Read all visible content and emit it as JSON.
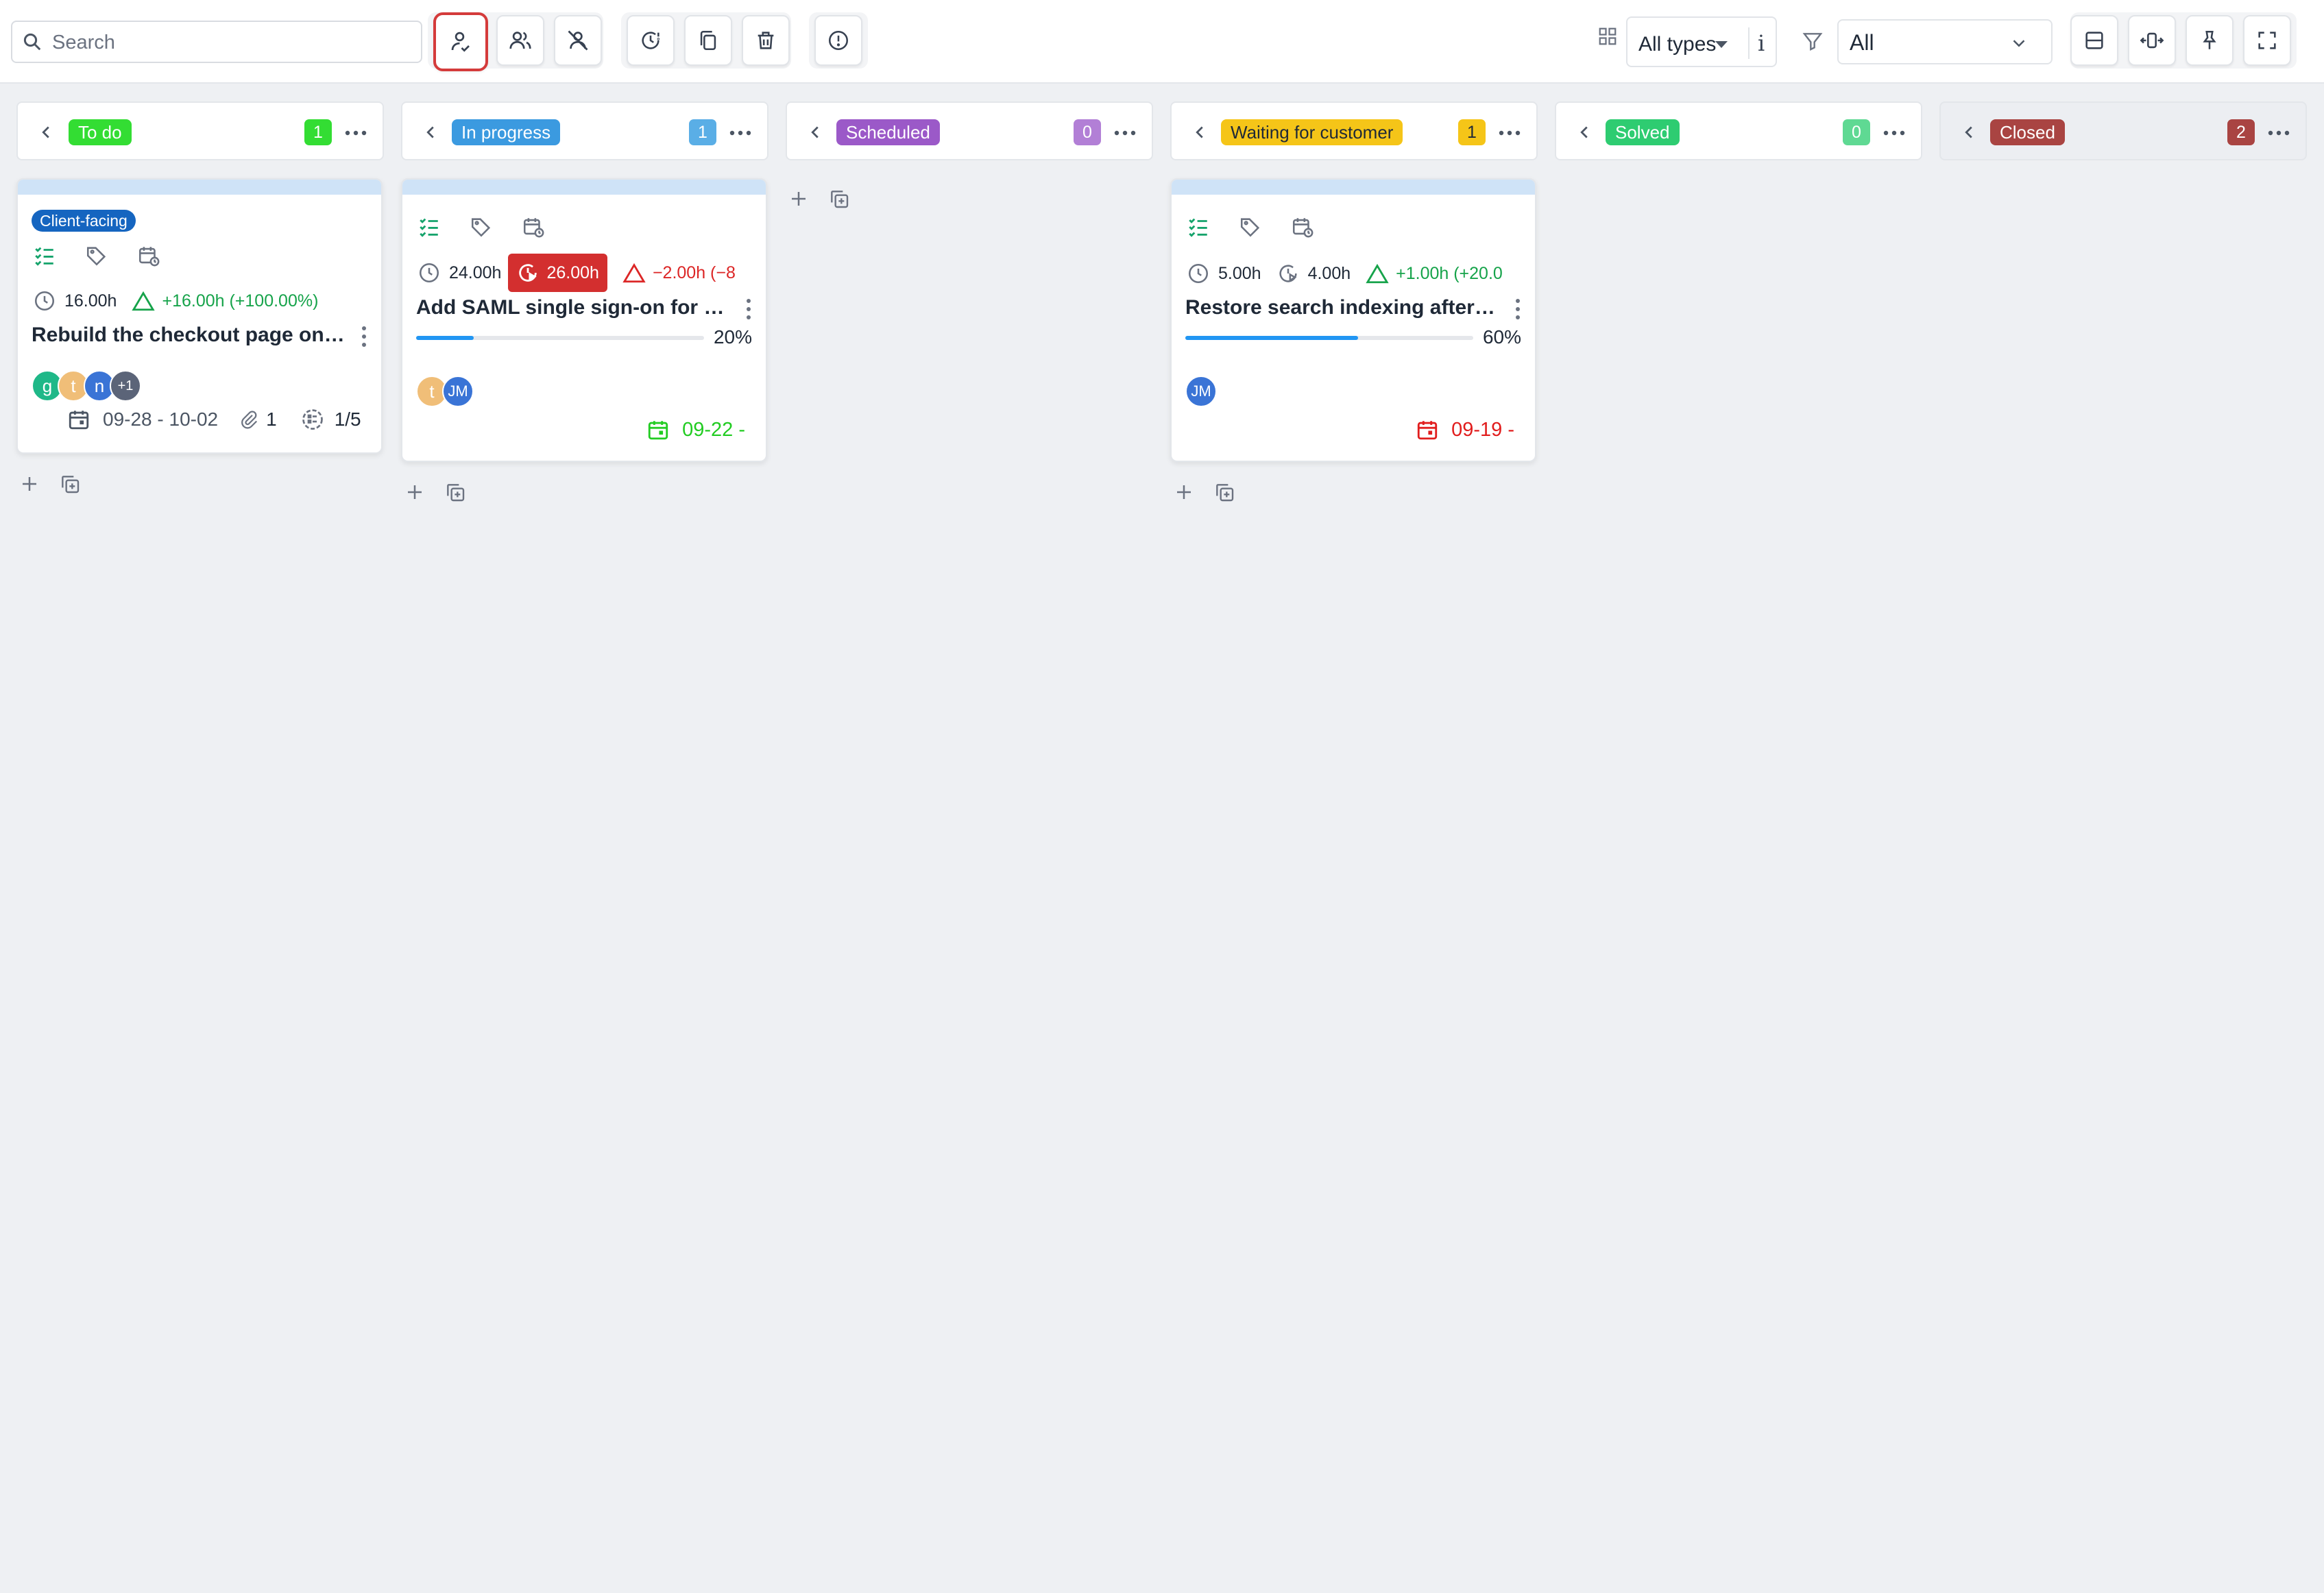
{
  "toolbar": {
    "search_placeholder": "Search",
    "types_value": "All types",
    "types_info": "i",
    "filter_value": "All"
  },
  "colors": {
    "todo": "#33dd33",
    "in_progress": "#3b9ae0",
    "scheduled": "#9b59c8",
    "waiting": "#f5c518",
    "solved": "#2ecc71",
    "closed": "#a94442"
  },
  "columns": [
    {
      "name": "To do",
      "count": "1"
    },
    {
      "name": "In progress",
      "count": "1"
    },
    {
      "name": "Scheduled",
      "count": "0"
    },
    {
      "name": "Waiting for customer",
      "count": "1"
    },
    {
      "name": "Solved",
      "count": "0"
    },
    {
      "name": "Closed",
      "count": "2"
    }
  ],
  "cards": {
    "todo": {
      "label": "Client-facing",
      "estimate": "16.00h",
      "variance": "+16.00h (+100.00%)",
      "title": "Rebuild the checkout page on th...",
      "avatars": [
        "g",
        "t",
        "n",
        "+1"
      ],
      "dates": "09-28 - 10-02",
      "attachments": "1",
      "checklist": "1/5"
    },
    "in_progress": {
      "estimate": "24.00h",
      "spent": "26.00h",
      "variance": "−2.00h (−8",
      "title": "Add SAML single sign-on for staf...",
      "progress": 20,
      "progress_label": "20%",
      "avatars": [
        "t",
        "JM"
      ],
      "due": "09-22 -"
    },
    "waiting": {
      "estimate": "5.00h",
      "spent": "4.00h",
      "variance": "+1.00h (+20.0",
      "title": "Restore search indexing after th...",
      "progress": 60,
      "progress_label": "60%",
      "avatars": [
        "JM"
      ],
      "due": "09-19 -"
    }
  }
}
